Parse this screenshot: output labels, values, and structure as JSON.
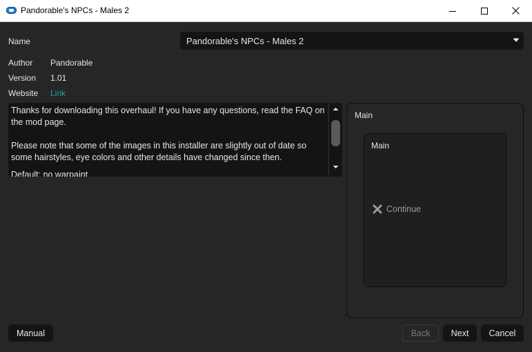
{
  "window": {
    "title": "Pandorable's NPCs - Males 2"
  },
  "info": {
    "name_label": "Name",
    "name_value": "Pandorable's NPCs - Males 2",
    "author_label": "Author",
    "author_value": "Pandorable",
    "version_label": "Version",
    "version_value": "1.01",
    "website_label": "Website",
    "website_link": "Link"
  },
  "description": {
    "para1": "Thanks for downloading this overhaul! If you have any questions, read the FAQ on the mod page.",
    "para2": "Please note that some of the images in this installer are slightly out of date so some hairstyles, eye colors and other details have changed since then.",
    "para3": "Default: no warpaint"
  },
  "steps": {
    "group_label": "Main",
    "inner_label": "Main",
    "option_label": "Continue"
  },
  "buttons": {
    "manual": "Manual",
    "back": "Back",
    "next": "Next",
    "cancel": "Cancel"
  },
  "colors": {
    "background": "#262626",
    "field": "#141414",
    "link": "#1f9d9d",
    "app_icon": "#2a7fd6"
  }
}
